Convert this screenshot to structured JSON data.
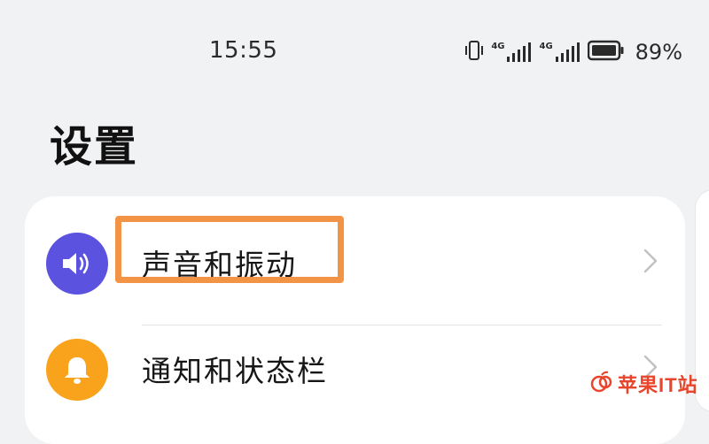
{
  "status_bar": {
    "time": "15:55",
    "battery_percent": "89%",
    "network_1": "4G",
    "network_2": "4G",
    "icons": [
      "vibrate-icon",
      "signal-4g-icon",
      "signal-4g-icon",
      "battery-icon"
    ]
  },
  "page": {
    "title": "设置"
  },
  "settings_items": [
    {
      "label": "声音和振动",
      "icon": "speaker-icon",
      "icon_color": "#5b52e0",
      "highlighted": true
    },
    {
      "label": "通知和状态栏",
      "icon": "bell-icon",
      "icon_color": "#f9a21b",
      "highlighted": false
    }
  ],
  "colors": {
    "background": "#f1f2f4",
    "card": "#ffffff",
    "highlight": "#f39345",
    "watermark": "#e8452c"
  },
  "watermark": {
    "text": "苹果IT站"
  }
}
